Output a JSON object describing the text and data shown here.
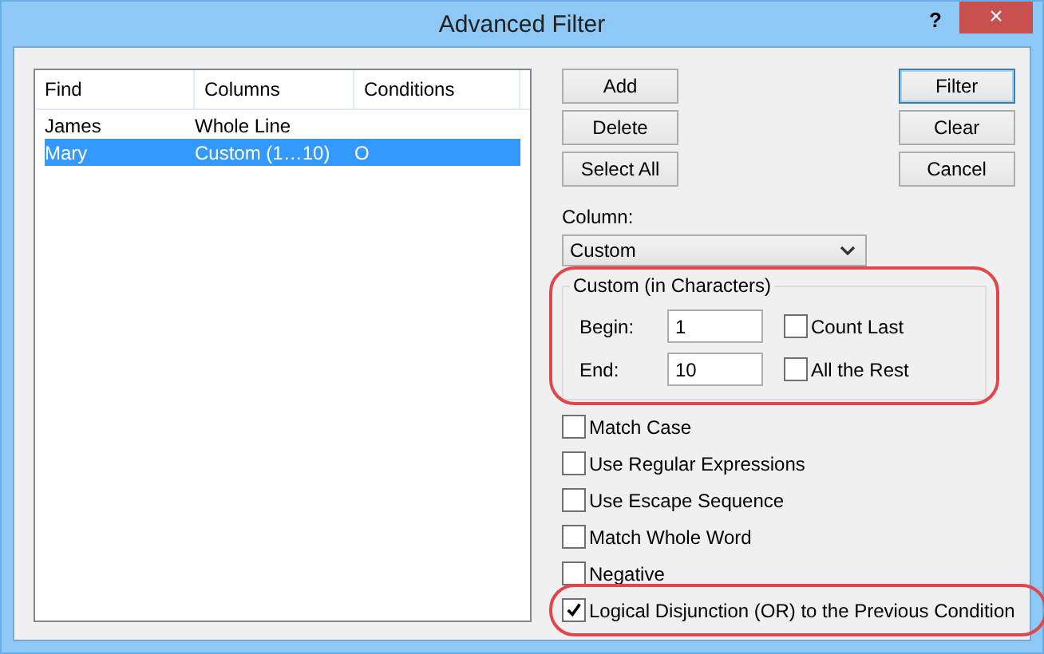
{
  "window": {
    "title": "Advanced Filter",
    "help": "?",
    "close": "×"
  },
  "table": {
    "columns": [
      "Find",
      "Columns",
      "Conditions"
    ],
    "rows": [
      {
        "cells": [
          "James",
          "Whole Line",
          ""
        ],
        "selected": false
      },
      {
        "cells": [
          "Mary",
          "Custom (1…10)",
          "O"
        ],
        "selected": true
      }
    ]
  },
  "buttons_left": [
    "Add",
    "Delete",
    "Select All"
  ],
  "buttons_right": [
    {
      "label": "Filter",
      "default": true
    },
    {
      "label": "Clear",
      "default": false
    },
    {
      "label": "Cancel",
      "default": false
    }
  ],
  "column": {
    "label": "Column:",
    "value": "Custom"
  },
  "custom_group": {
    "title": "Custom (in Characters)",
    "highlighted": true,
    "fields": [
      {
        "label": "Begin:",
        "value": "1",
        "option": "Count Last",
        "checked": false
      },
      {
        "label": "End:",
        "value": "10",
        "option": "All the Rest",
        "checked": false
      }
    ]
  },
  "options": [
    {
      "label": "Match Case",
      "checked": false,
      "highlighted": false
    },
    {
      "label": "Use Regular Expressions",
      "checked": false,
      "highlighted": false
    },
    {
      "label": "Use Escape Sequence",
      "checked": false,
      "highlighted": false
    },
    {
      "label": "Match Whole Word",
      "checked": false,
      "highlighted": false
    },
    {
      "label": "Negative",
      "checked": false,
      "highlighted": false
    },
    {
      "label": "Logical Disjunction (OR) to the Previous Condition",
      "checked": true,
      "highlighted": true
    }
  ]
}
